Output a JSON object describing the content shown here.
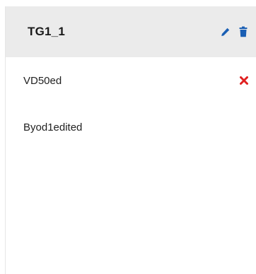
{
  "group": {
    "title": "TG1_1",
    "edit_icon": "pencil-icon",
    "delete_icon": "trash-icon",
    "accent_color": "#1a5fb4"
  },
  "members": [
    {
      "name": "VD50ed",
      "removable": true,
      "remove_icon": "close-icon",
      "remove_color": "#e02020"
    },
    {
      "name": "Byod1edited",
      "removable": false
    }
  ]
}
